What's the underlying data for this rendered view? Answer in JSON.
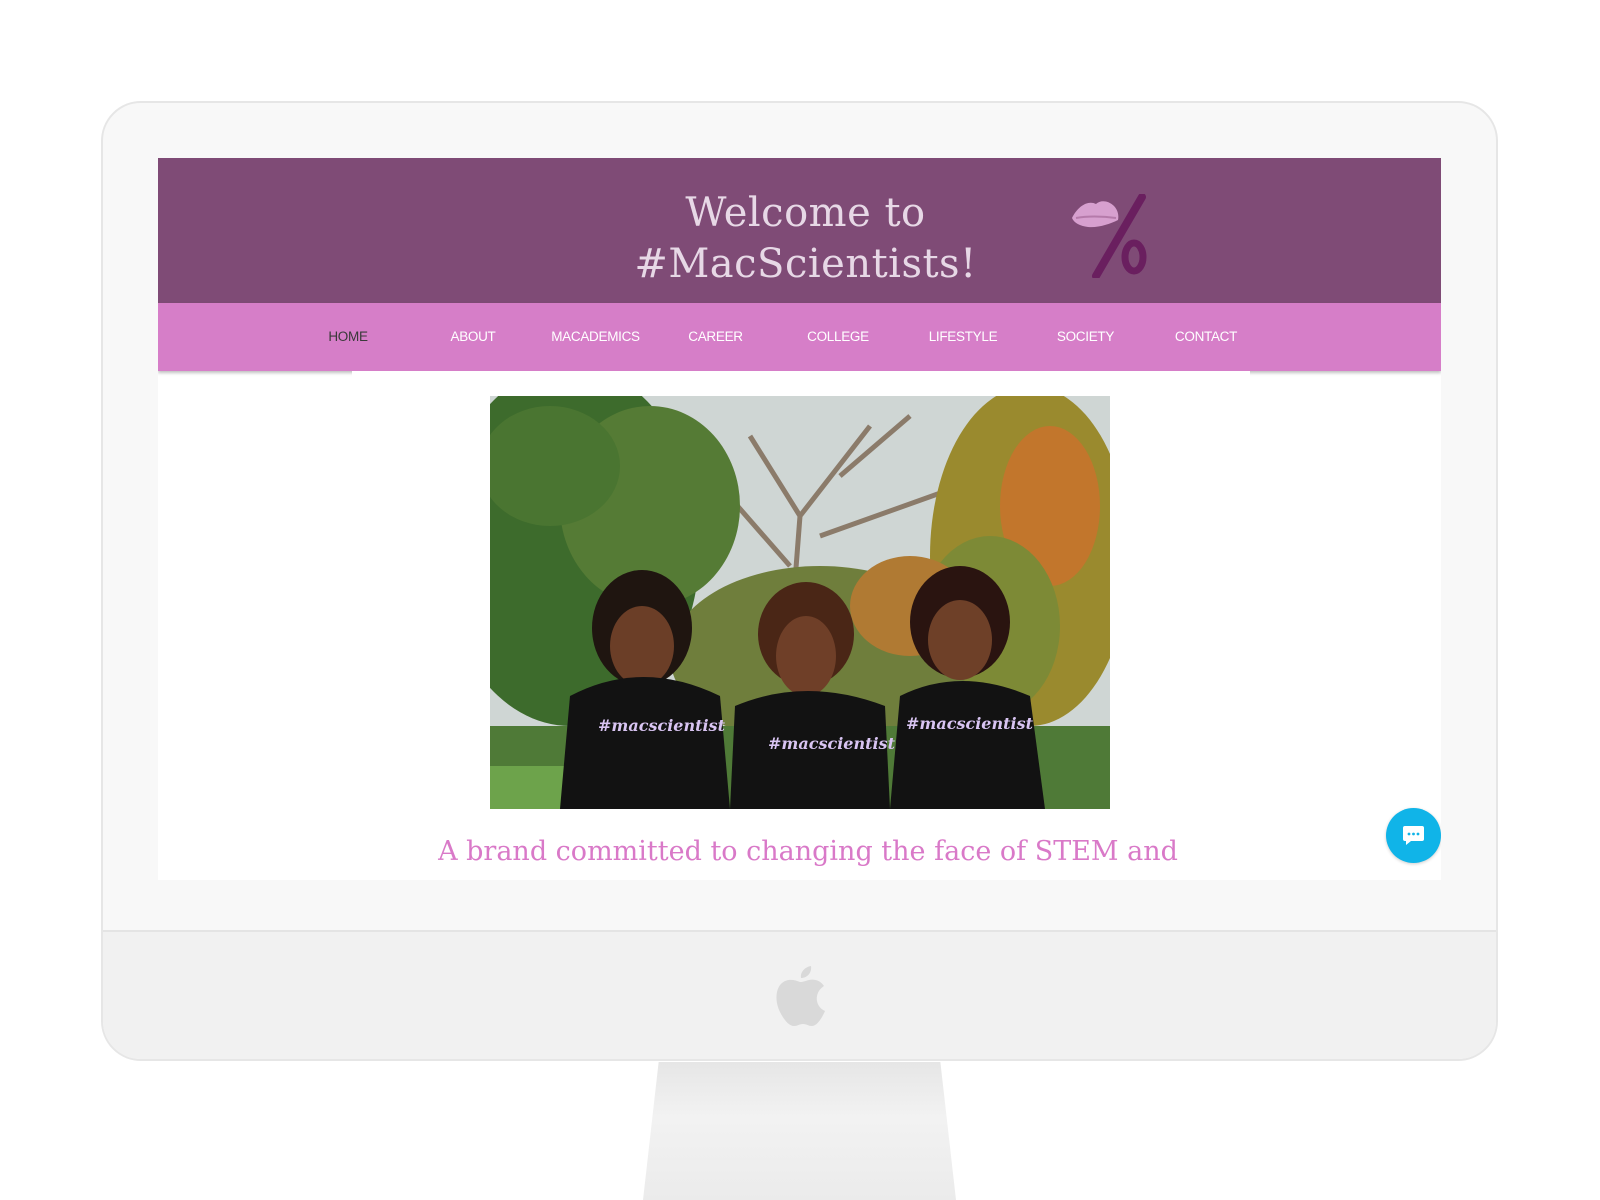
{
  "header": {
    "title_line1": "Welcome to",
    "title_line2": "#MacScientists!",
    "logo_icon": "lips-percent-logo"
  },
  "nav": {
    "items": [
      {
        "label": "HOME",
        "active": true
      },
      {
        "label": "ABOUT"
      },
      {
        "label": "MACADEMICS"
      },
      {
        "label": "CAREER"
      },
      {
        "label": "COLLEGE"
      },
      {
        "label": "LIFESTYLE"
      },
      {
        "label": "SOCIETY"
      },
      {
        "label": "CONTACT"
      }
    ]
  },
  "hero": {
    "shirt_text": "#macscientist"
  },
  "main": {
    "tagline": "A brand committed to changing the face of STEM and"
  },
  "chat": {
    "icon": "chat-bubble-icon"
  },
  "device": {
    "logo": "apple-logo"
  },
  "colors": {
    "header_bg": "#7f4b76",
    "nav_bg": "#d67ec8",
    "accent_text": "#d979c8",
    "chat_button": "#10b4e8"
  }
}
